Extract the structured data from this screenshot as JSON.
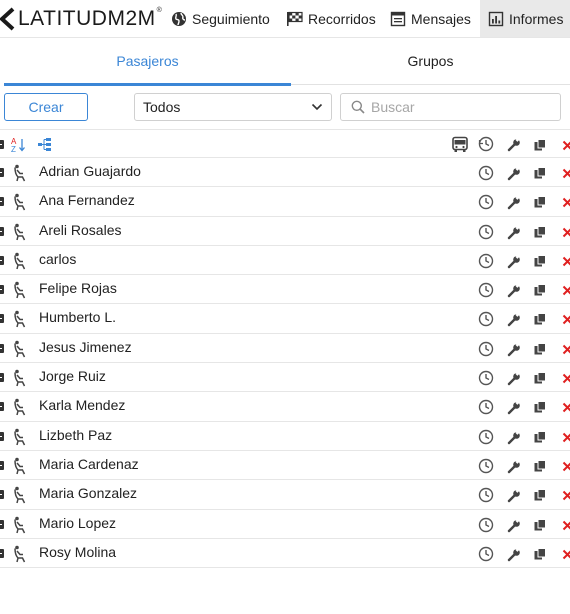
{
  "app": {
    "logo_text": "LATITUD",
    "logo_suffix": "M2M",
    "logo_reg": "®"
  },
  "nav": {
    "items": [
      {
        "label": "Seguimiento",
        "icon": "globe-icon"
      },
      {
        "label": "Recorridos",
        "icon": "checkered-flag-icon"
      },
      {
        "label": "Mensajes",
        "icon": "list-doc-icon"
      },
      {
        "label": "Informes",
        "icon": "report-chart-icon",
        "active": true
      }
    ]
  },
  "tabs": [
    {
      "label": "Pasajeros",
      "active": true
    },
    {
      "label": "Grupos",
      "active": false
    }
  ],
  "toolbar": {
    "create_label": "Crear",
    "filter_selected": "Todos",
    "search_placeholder": "Buscar"
  },
  "colors": {
    "accent": "#3b86d6",
    "delete": "#e02020",
    "icon": "#555555"
  },
  "passengers": [
    {
      "name": "Adrian Guajardo"
    },
    {
      "name": "Ana Fernandez"
    },
    {
      "name": "Areli Rosales"
    },
    {
      "name": "carlos"
    },
    {
      "name": "Felipe Rojas"
    },
    {
      "name": "Humberto L."
    },
    {
      "name": "Jesus Jimenez"
    },
    {
      "name": "Jorge Ruiz"
    },
    {
      "name": "Karla Mendez"
    },
    {
      "name": "Lizbeth Paz"
    },
    {
      "name": "Maria Cardenaz"
    },
    {
      "name": "Maria Gonzalez"
    },
    {
      "name": "Mario Lopez"
    },
    {
      "name": "Rosy Molina"
    }
  ]
}
